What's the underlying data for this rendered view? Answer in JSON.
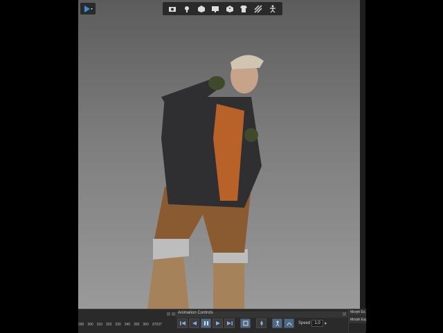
{
  "toolbar": {
    "icons": [
      "camera-icon",
      "light-icon",
      "cube-icon",
      "monitor-icon",
      "dice-icon",
      "tshirt-icon",
      "grid-icon",
      "figure-icon"
    ]
  },
  "bottom_panel": {
    "title": "Animation Controls",
    "timeline_numbers": [
      "290",
      "300",
      "310",
      "320",
      "330",
      "340",
      "350",
      "360",
      "37037"
    ],
    "speed_label": "Speed",
    "speed_value": "1.0"
  },
  "morph_panel": {
    "tab1": "Morph Ex...",
    "tab2": "Morph Exp"
  },
  "colors": {
    "panel_bg": "#2a2a2a",
    "accent": "#4b6a8a"
  }
}
